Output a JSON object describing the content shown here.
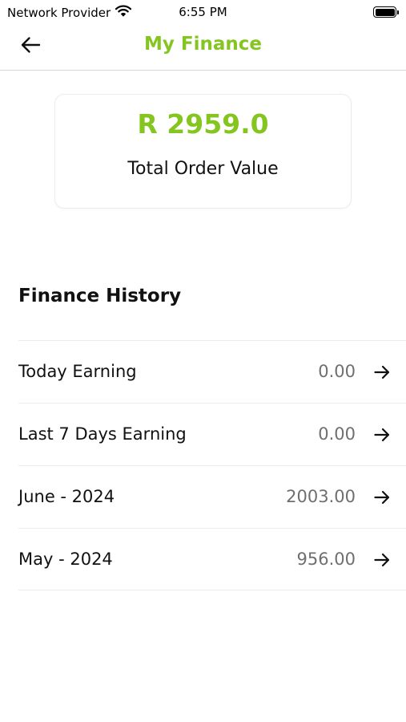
{
  "status_bar": {
    "carrier": "Network Provider",
    "time": "6:55 PM",
    "wifi_icon": "wifi-icon",
    "battery_icon": "battery-icon"
  },
  "header": {
    "back_icon": "arrow-left-icon",
    "title": "My Finance"
  },
  "summary": {
    "amount": "R 2959.0",
    "label": "Total Order Value"
  },
  "finance_history": {
    "title": "Finance History",
    "rows": [
      {
        "label": "Today Earning",
        "value": "0.00",
        "icon": "arrow-right-icon"
      },
      {
        "label": "Last 7 Days Earning",
        "value": "0.00",
        "icon": "arrow-right-icon"
      },
      {
        "label": "June - 2024",
        "value": "2003.00",
        "icon": "arrow-right-icon"
      },
      {
        "label": "May - 2024",
        "value": "956.00",
        "icon": "arrow-right-icon"
      }
    ]
  },
  "colors": {
    "accent": "#84c51f",
    "text_primary": "#111111",
    "text_secondary": "#6f6f6f",
    "divider": "#ececec"
  }
}
